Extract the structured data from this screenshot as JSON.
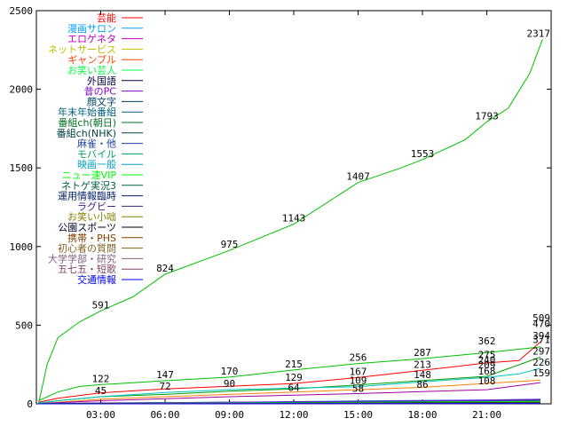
{
  "chart_data": {
    "type": "line",
    "title": "",
    "xlabel": "",
    "ylabel": "",
    "xlim": [
      0,
      24
    ],
    "ylim": [
      0,
      2500
    ],
    "grid": false,
    "legend_position": "top-left",
    "y_ticks": [
      0,
      500,
      1000,
      1500,
      2000,
      2500
    ],
    "x_ticks": [
      {
        "value": 3,
        "label": "03:00"
      },
      {
        "value": 6,
        "label": "06:00"
      },
      {
        "value": 9,
        "label": "09:00"
      },
      {
        "value": 12,
        "label": "12:00"
      },
      {
        "value": 15,
        "label": "15:00"
      },
      {
        "value": 18,
        "label": "18:00"
      },
      {
        "value": 21,
        "label": "21:00"
      }
    ],
    "series": [
      {
        "name": "芸能",
        "color": "#ff0000",
        "x": [
          0.1,
          1,
          3,
          6,
          9,
          12,
          15,
          18,
          21,
          22.5,
          23.5
        ],
        "y": [
          10,
          35,
          70,
          95,
          112,
          129,
          167,
          213,
          260,
          275,
          394
        ]
      },
      {
        "name": "漫画サロン",
        "color": "#00c000",
        "x": [
          0.1,
          1,
          2,
          3,
          6,
          9,
          12,
          15,
          18,
          21,
          23.5
        ],
        "y": [
          20,
          75,
          110,
          122,
          147,
          170,
          215,
          256,
          287,
          325,
          362
        ]
      },
      {
        "name": "エロゲネタ",
        "color": "#0080ff",
        "x": [
          0.1,
          3,
          6,
          9,
          12,
          15,
          18,
          21,
          23.5
        ],
        "y": [
          3,
          5,
          8,
          10,
          14,
          18,
          22,
          25,
          30
        ]
      },
      {
        "name": "ネットサービス",
        "color": "#c000ff",
        "x": [
          0.1,
          3,
          6,
          9,
          12,
          15,
          18,
          21,
          23.5
        ],
        "y": [
          2,
          4,
          6,
          9,
          12,
          15,
          19,
          23,
          28
        ]
      },
      {
        "name": "ギャンブル",
        "color": "#00eeee",
        "x": [
          0.1,
          3,
          6,
          9,
          12,
          15,
          18,
          21,
          23.5
        ],
        "y": [
          2,
          3,
          5,
          7,
          10,
          13,
          16,
          20,
          24
        ]
      },
      {
        "name": "お笑い芸人",
        "color": "#c0a000",
        "x": [
          0.1,
          3,
          6,
          9,
          12,
          15,
          18,
          21,
          23.5
        ],
        "y": [
          1,
          3,
          4,
          6,
          8,
          11,
          14,
          17,
          21
        ]
      },
      {
        "name": "外国語",
        "color": "#00c000",
        "x": [
          0.1,
          0.5,
          1,
          2,
          3,
          4.5,
          6,
          9,
          12,
          15,
          17,
          18,
          20,
          21,
          22,
          23,
          23.6
        ],
        "y": [
          0,
          250,
          420,
          520,
          591,
          680,
          824,
          975,
          1143,
          1407,
          1500,
          1553,
          1680,
          1793,
          1880,
          2100,
          2317
        ]
      },
      {
        "name": "昔のPC",
        "color": "#404040",
        "x": [
          0.1,
          3,
          6,
          9,
          12,
          15,
          18,
          21,
          23.5
        ],
        "y": [
          0,
          5,
          8,
          10,
          13,
          15,
          18,
          21,
          26
        ]
      },
      {
        "name": "顔文字",
        "color": "#000000",
        "x": [
          0.1,
          3,
          6,
          9,
          12,
          15,
          18,
          21,
          23.5
        ],
        "y": [
          0,
          3,
          5,
          8,
          10,
          13,
          15,
          18,
          22
        ]
      },
      {
        "name": "年末年始番組",
        "color": "#8000ff",
        "x": [
          0.1,
          3,
          6,
          9,
          12,
          15,
          18,
          21,
          23.5
        ],
        "y": [
          0,
          4,
          7,
          9,
          12,
          14,
          17,
          20,
          23
        ]
      },
      {
        "name": "番組ch(朝日)",
        "color": "#008080",
        "x": [
          0.1,
          3,
          6,
          9,
          12,
          15,
          18,
          21,
          23.5
        ],
        "y": [
          0,
          2,
          4,
          6,
          9,
          11,
          14,
          16,
          19
        ]
      },
      {
        "name": "番組ch(NHK)",
        "color": "#006060",
        "x": [
          0.1,
          3,
          6,
          9,
          12,
          15,
          18,
          21,
          23.5
        ],
        "y": [
          0,
          2,
          3,
          5,
          7,
          9,
          11,
          13,
          16
        ]
      },
      {
        "name": "麻雀・他",
        "color": "#0000c0",
        "x": [
          0.1,
          3,
          6,
          9,
          12,
          15,
          18,
          21,
          23.5
        ],
        "y": [
          0,
          1,
          3,
          4,
          6,
          8,
          10,
          12,
          14
        ]
      },
      {
        "name": "モバイル",
        "color": "#008000",
        "x": [
          0.1,
          3,
          6,
          9,
          12,
          15,
          18,
          21,
          23.5
        ],
        "y": [
          0,
          1,
          2,
          4,
          5,
          7,
          9,
          11,
          13
        ]
      },
      {
        "name": "映画一般",
        "color": "#00a0a0",
        "x": [
          0.1,
          3,
          6,
          9,
          12,
          15,
          18,
          21,
          23.5
        ],
        "y": [
          0,
          1,
          2,
          3,
          5,
          6,
          8,
          10,
          12
        ]
      },
      {
        "name": "ニュー速VIP",
        "color": "#00c0c0",
        "x": [
          0.1,
          1,
          3,
          6,
          9,
          12,
          15,
          18,
          21,
          22.5,
          23.5
        ],
        "y": [
          5,
          20,
          45,
          72,
          90,
          100,
          109,
          140,
          168,
          190,
          226
        ]
      },
      {
        "name": "ネトゲ実況3",
        "color": "#00ff00",
        "x": [
          0.1,
          3,
          6,
          9,
          12,
          15,
          18,
          21,
          23.5
        ],
        "y": [
          0,
          2,
          4,
          5,
          7,
          9,
          11,
          13,
          16
        ]
      },
      {
        "name": "運用情報臨時",
        "color": "#404040",
        "x": [
          0.1,
          3,
          6,
          9,
          12,
          15,
          18,
          21,
          23.5
        ],
        "y": [
          0,
          1,
          2,
          3,
          4,
          5,
          7,
          8,
          10
        ]
      },
      {
        "name": "ラグビー",
        "color": "#000080",
        "x": [
          0.1,
          3,
          6,
          9,
          12,
          15,
          18,
          21,
          23.5
        ],
        "y": [
          0,
          1,
          2,
          2,
          3,
          4,
          5,
          6,
          8
        ]
      },
      {
        "name": "お笑い小咄",
        "color": "#606000",
        "x": [
          0.1,
          3,
          6,
          9,
          12,
          15,
          18,
          21,
          23.5
        ],
        "y": [
          0,
          1,
          1,
          2,
          3,
          4,
          5,
          6,
          7
        ]
      },
      {
        "name": "公園スポーツ",
        "color": "#000000",
        "x": [
          0.1,
          3,
          6,
          9,
          12,
          15,
          18,
          21,
          23.5
        ],
        "y": [
          0,
          1,
          1,
          2,
          2,
          3,
          4,
          5,
          6
        ]
      },
      {
        "name": "携帯・PHS",
        "color": "#806000",
        "x": [
          0.1,
          3,
          6,
          9,
          12,
          15,
          18,
          21,
          23.5
        ],
        "y": [
          0,
          1,
          1,
          2,
          2,
          3,
          3,
          4,
          5
        ]
      },
      {
        "name": "初心者の質問",
        "color": "#808000",
        "x": [
          0.1,
          3,
          6,
          9,
          12,
          15,
          18,
          21,
          23.5
        ],
        "y": [
          0,
          0,
          1,
          1,
          2,
          2,
          3,
          3,
          4
        ]
      },
      {
        "name": "大学学部・研究",
        "color": "#606060",
        "x": [
          0.1,
          3,
          6,
          9,
          12,
          15,
          18,
          21,
          23.5
        ],
        "y": [
          0,
          0,
          1,
          1,
          1,
          2,
          2,
          3,
          3
        ]
      },
      {
        "name": "五七五・短歌",
        "color": "#800080",
        "x": [
          0.1,
          3,
          6,
          9,
          12,
          15,
          18,
          21,
          23.5
        ],
        "y": [
          0,
          0,
          0,
          1,
          1,
          1,
          2,
          2,
          3
        ]
      },
      {
        "name": "交通情報",
        "color": "#0000ff",
        "x": [
          0.1,
          3,
          6,
          9,
          12,
          15,
          18,
          21,
          23.5
        ],
        "y": [
          0,
          0,
          0,
          0,
          1,
          1,
          1,
          2,
          2
        ]
      }
    ],
    "extra_lines": [
      {
        "color": "#00a000",
        "x": [
          0.1,
          1,
          3,
          6,
          9,
          12,
          15,
          18,
          21,
          23.5
        ],
        "y": [
          4,
          20,
          45,
          60,
          80,
          95,
          120,
          148,
          175,
          297
        ]
      },
      {
        "color": "#ff8000",
        "x": [
          0.1,
          1,
          3,
          6,
          9,
          12,
          15,
          18,
          21,
          23.5
        ],
        "y": [
          2,
          10,
          30,
          45,
          60,
          75,
          90,
          105,
          130,
          150
        ]
      },
      {
        "color": "#a000a0",
        "x": [
          0.1,
          3,
          6,
          9,
          12,
          15,
          18,
          21,
          23.5
        ],
        "y": [
          1,
          20,
          32,
          45,
          55,
          65,
          78,
          90,
          135
        ]
      }
    ],
    "data_labels": [
      {
        "x": 3,
        "y": 591,
        "text": "591"
      },
      {
        "x": 6,
        "y": 824,
        "text": "824"
      },
      {
        "x": 9,
        "y": 975,
        "text": "975"
      },
      {
        "x": 12,
        "y": 1143,
        "text": "1143"
      },
      {
        "x": 15,
        "y": 1407,
        "text": "1407"
      },
      {
        "x": 18,
        "y": 1553,
        "text": "1553"
      },
      {
        "x": 21,
        "y": 1793,
        "text": "1793"
      },
      {
        "x": 23.6,
        "y": 2317,
        "text": "2317"
      },
      {
        "x": 3,
        "y": 122,
        "text": "122"
      },
      {
        "x": 6,
        "y": 147,
        "text": "147"
      },
      {
        "x": 9,
        "y": 170,
        "text": "170"
      },
      {
        "x": 12,
        "y": 215,
        "text": "215"
      },
      {
        "x": 15,
        "y": 256,
        "text": "256"
      },
      {
        "x": 18,
        "y": 287,
        "text": "287"
      },
      {
        "x": 21,
        "y": 362,
        "text": "362"
      },
      {
        "x": 23.6,
        "y": 509,
        "text": "509"
      },
      {
        "x": 23.6,
        "y": 470,
        "text": "470"
      },
      {
        "x": 23.6,
        "y": 394,
        "text": "394"
      },
      {
        "x": 23.6,
        "y": 371,
        "text": "371"
      },
      {
        "x": 23.6,
        "y": 297,
        "text": "297"
      },
      {
        "x": 23.6,
        "y": 226,
        "text": "226"
      },
      {
        "x": 23.6,
        "y": 159,
        "text": "159"
      },
      {
        "x": 12,
        "y": 129,
        "text": "129"
      },
      {
        "x": 15,
        "y": 167,
        "text": "167"
      },
      {
        "x": 18,
        "y": 213,
        "text": "213"
      },
      {
        "x": 21,
        "y": 275,
        "text": "275"
      },
      {
        "x": 21,
        "y": 240,
        "text": "240"
      },
      {
        "x": 15,
        "y": 109,
        "text": "109"
      },
      {
        "x": 18,
        "y": 148,
        "text": "148"
      },
      {
        "x": 21,
        "y": 168,
        "text": "168"
      },
      {
        "x": 21,
        "y": 209,
        "text": "209"
      },
      {
        "x": 21,
        "y": 108,
        "text": "108"
      },
      {
        "x": 6,
        "y": 72,
        "text": "72"
      },
      {
        "x": 9,
        "y": 90,
        "text": "90"
      },
      {
        "x": 3,
        "y": 45,
        "text": "45"
      },
      {
        "x": 12,
        "y": 64,
        "text": "64"
      },
      {
        "x": 15,
        "y": 58,
        "text": "58"
      },
      {
        "x": 18,
        "y": 86,
        "text": "86"
      }
    ]
  },
  "legend": {
    "entries": [
      {
        "label": "芸能",
        "color": "#ff0000"
      },
      {
        "label": "漫画サロン",
        "color": "#00a0ff"
      },
      {
        "label": "エロゲネタ",
        "color": "#c000c0"
      },
      {
        "label": "ネットサービス",
        "color": "#c0c000"
      },
      {
        "label": "ギャンブル",
        "color": "#ff4000"
      },
      {
        "label": "お笑い芸人",
        "color": "#00ff40"
      },
      {
        "label": "外国語",
        "color": "#000040"
      },
      {
        "label": "昔のPC",
        "color": "#8000c0"
      },
      {
        "label": "顔文字",
        "color": "#004060"
      },
      {
        "label": "年末年始番組",
        "color": "#006080"
      },
      {
        "label": "番組ch(朝日)",
        "color": "#007020"
      },
      {
        "label": "番組ch(NHK)",
        "color": "#004040"
      },
      {
        "label": "麻雀・他",
        "color": "#2040a0"
      },
      {
        "label": "モバイル",
        "color": "#00a060"
      },
      {
        "label": "映画一般",
        "color": "#00a0c0"
      },
      {
        "label": "ニュー速VIP",
        "color": "#00ff00"
      },
      {
        "label": "ネトゲ実況3",
        "color": "#006040"
      },
      {
        "label": "運用情報臨時",
        "color": "#002060"
      },
      {
        "label": "ラグビー",
        "color": "#402080"
      },
      {
        "label": "お笑い小咄",
        "color": "#808000"
      },
      {
        "label": "公園スポーツ",
        "color": "#000020"
      },
      {
        "label": "携帯・PHS",
        "color": "#804000"
      },
      {
        "label": "初心者の質問",
        "color": "#806020"
      },
      {
        "label": "大学学部・研究",
        "color": "#806080"
      },
      {
        "label": "五七五・短歌",
        "color": "#804060"
      },
      {
        "label": "交通情報",
        "color": "#0000ff"
      }
    ]
  }
}
